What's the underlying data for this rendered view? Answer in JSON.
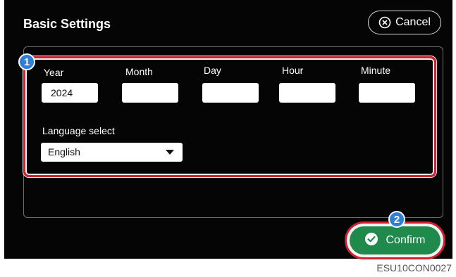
{
  "dialog": {
    "title": "Basic Settings",
    "cancel_label": "Cancel",
    "confirm_label": "Confirm"
  },
  "datetime": {
    "year_label": "Year",
    "year_value": "2024",
    "month_label": "Month",
    "month_value": "",
    "day_label": "Day",
    "day_value": "",
    "hour_label": "Hour",
    "hour_value": "",
    "minute_label": "Minute",
    "minute_value": ""
  },
  "language": {
    "label": "Language  select",
    "selected": "English"
  },
  "callouts": {
    "one": "1",
    "two": "2"
  },
  "caption": "ESU10CON0027",
  "icons": {
    "cancel": "circle-x-icon",
    "confirm": "circle-check-icon",
    "dropdown": "triangle-down-icon"
  },
  "colors": {
    "screen_background": "#050505",
    "highlight_red": "#d2202f",
    "callout_blue": "#2f7fd6",
    "confirm_green": "#1f8a4c"
  }
}
